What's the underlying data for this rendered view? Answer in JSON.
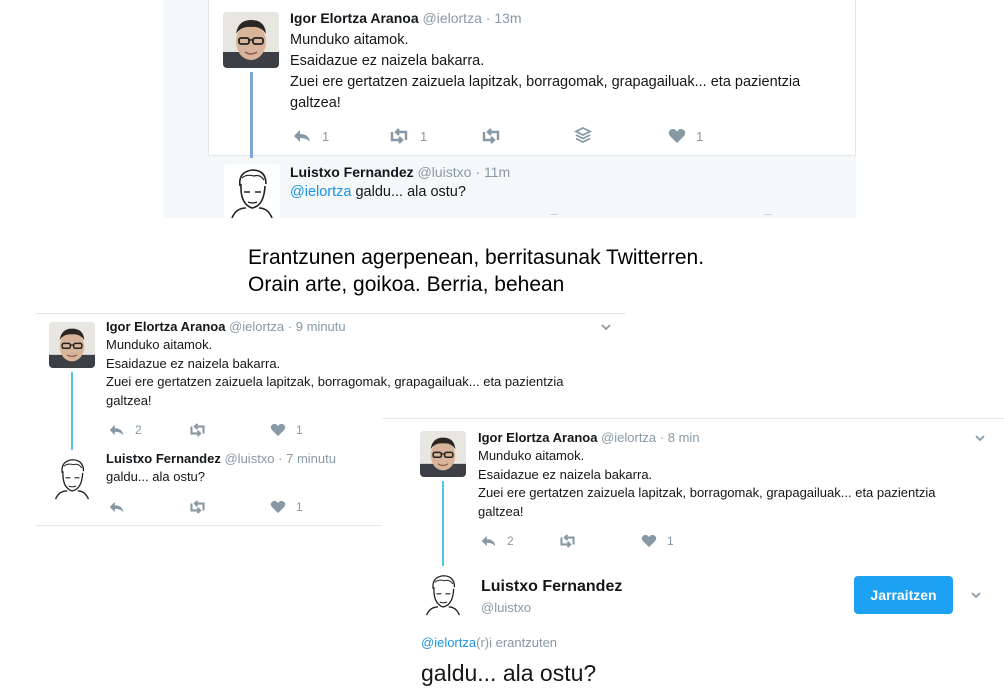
{
  "top": {
    "tweet": {
      "name": "Igor Elortza Aranoa",
      "handle": "@ielortza",
      "separator": "·",
      "time": "13m",
      "lines": [
        "Munduko aitamok.",
        "Esaidazue ez naizela bakarra.",
        "Zuei ere gertatzen zaizuela lapitzak, borragomak, grapagailuak... eta pazientzia",
        "galtzea!"
      ],
      "reply_count": "1",
      "retweet_count": "1",
      "like_count": "1",
      "icons": [
        "reply-icon",
        "retweet-icon",
        "retweet-outline-icon",
        "stack-icon",
        "heart-icon"
      ]
    },
    "reply": {
      "name": "Luistxo Fernandez",
      "handle": "@luistxo",
      "separator": "·",
      "time": "11m",
      "mention": "@ielortza",
      "text": " galdu... ala ostu?"
    }
  },
  "caption": {
    "line1": "Erantzunen agerpenean, berritasunak Twitterren.",
    "line2": "Orain arte, goikoa. Berria, behean"
  },
  "old": {
    "tweet": {
      "name": "Igor Elortza Aranoa",
      "handle": "@ielortza",
      "separator": "·",
      "time": "9 minutu",
      "lines": [
        "Munduko aitamok.",
        "Esaidazue ez naizela bakarra.",
        "Zuei ere gertatzen zaizuela lapitzak, borragomak, grapagailuak... eta pazientzia",
        "galtzea!"
      ],
      "reply_count": "2",
      "like_count": "1"
    },
    "reply": {
      "name": "Luistxo Fernandez",
      "handle": "@luistxo",
      "separator": "·",
      "time": "7 minutu",
      "text": "galdu... ala ostu?",
      "like_count": "1"
    }
  },
  "new": {
    "tweet": {
      "name": "Igor Elortza Aranoa",
      "handle": "@ielortza",
      "separator": "·",
      "time": "8 min",
      "lines": [
        "Munduko aitamok.",
        "Esaidazue ez naizela bakarra.",
        "Zuei ere gertatzen zaizuela lapitzak, borragomak, grapagailuak... eta pazientzia",
        "galtzea!"
      ],
      "reply_count": "2",
      "like_count": "1"
    },
    "reply": {
      "name": "Luistxo Fernandez",
      "handle": "@luistxo",
      "follow_label": "Jarraitzen",
      "replying_mention": "@ielortza",
      "replying_suffix": "(r)i erantzuten",
      "text": "galdu... ala ostu?"
    }
  },
  "colors": {
    "link": "#1b95e0",
    "muted": "#8899a6",
    "follow_button": "#1da1f2",
    "thread_line_top": "#7fa8d8",
    "thread_line_bottom": "#4ec6e3"
  }
}
